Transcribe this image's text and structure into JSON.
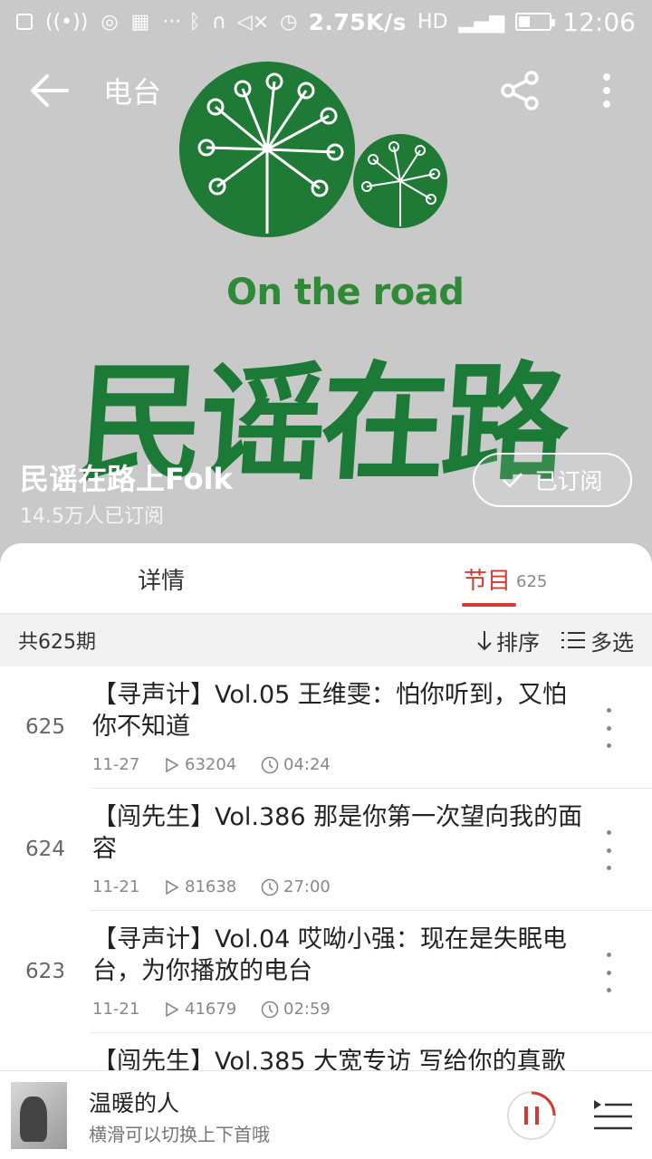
{
  "status_bar": {
    "speed": "2.75K/s",
    "network": "HD",
    "time": "12:06"
  },
  "header": {
    "title": "电台",
    "logo_en": "On the road",
    "logo_cn": "民谣在路上"
  },
  "channel": {
    "name": "民谣在路上Folk",
    "subscribers": "14.5万人已订阅",
    "subscribe_label": "已订阅"
  },
  "tabs": {
    "details": "详情",
    "programs": "节目",
    "programs_count": "625"
  },
  "list_header": {
    "total": "共625期",
    "sort": "排序",
    "multi_select": "多选"
  },
  "episodes": [
    {
      "num": "625",
      "title": "【寻声计】Vol.05 王维雯：怕你听到，又怕你不知道",
      "date": "11-27",
      "plays": "63204",
      "duration": "04:24"
    },
    {
      "num": "624",
      "title": "【闯先生】Vol.386 那是你第一次望向我的面容",
      "date": "11-21",
      "plays": "81638",
      "duration": "27:00"
    },
    {
      "num": "623",
      "title": "【寻声计】Vol.04 哎呦小强：现在是失眠电台，为你播放的电台",
      "date": "11-21",
      "plays": "41679",
      "duration": "02:59"
    },
    {
      "num": "",
      "title": "【闯先生】Vol.385 大宽专访 写给你的真歌",
      "date": "",
      "plays": "",
      "duration": ""
    }
  ],
  "player": {
    "song": "温暖的人",
    "hint": "横滑可以切换上下首哦"
  },
  "colors": {
    "accent": "#d33a31",
    "logo_green": "#1e7a35",
    "cover_bg": "#c9c9c9"
  }
}
